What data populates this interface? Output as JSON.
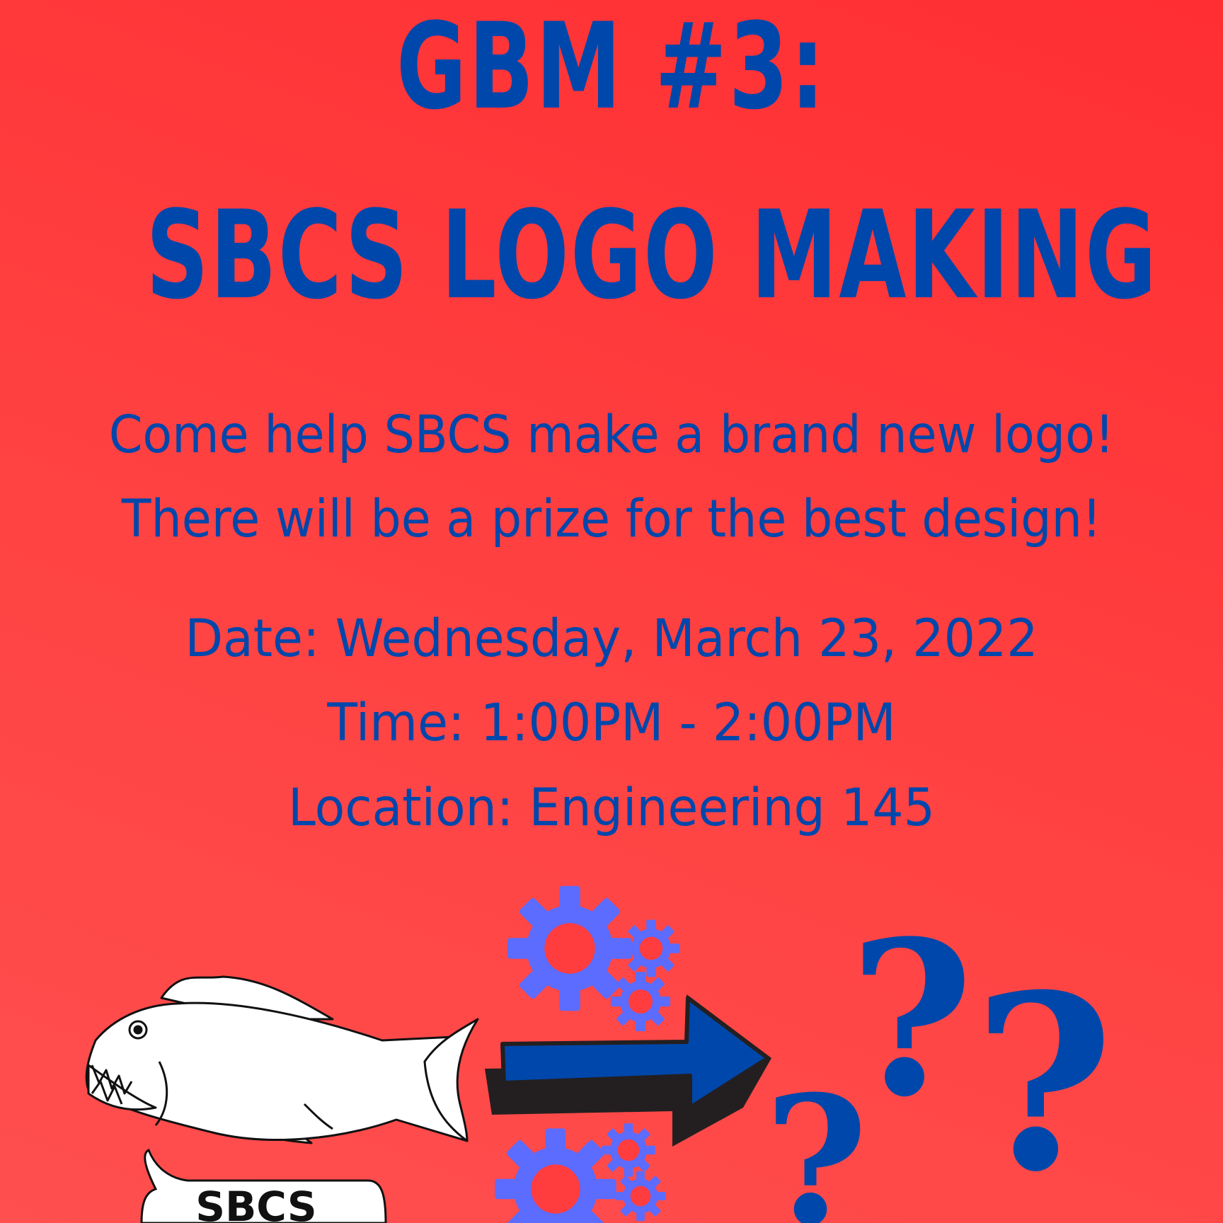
{
  "title": {
    "line1": "GBM #3:",
    "line2": "SBCS LOGO MAKING"
  },
  "description": {
    "line1": "Come help SBCS make a brand new logo!",
    "line2": "There will be a prize for the best design!"
  },
  "details": {
    "date": "Date: Wednesday, March 23, 2022",
    "time": "Time: 1:00PM - 2:00PM",
    "location": "Location: Engineering 145"
  },
  "illustration": {
    "bubble_text": "SBCS",
    "icons": [
      "piranha-fish-icon",
      "gear-icon",
      "arrow-right-icon",
      "question-mark-icon"
    ]
  },
  "colors": {
    "background_top": "#ff2e32",
    "background_bottom": "#ff4f4f",
    "text_blue": "#0047ab",
    "gear_blue": "#5b6cff",
    "arrow_blue": "#0047ab",
    "arrow_shadow": "#231f20"
  }
}
